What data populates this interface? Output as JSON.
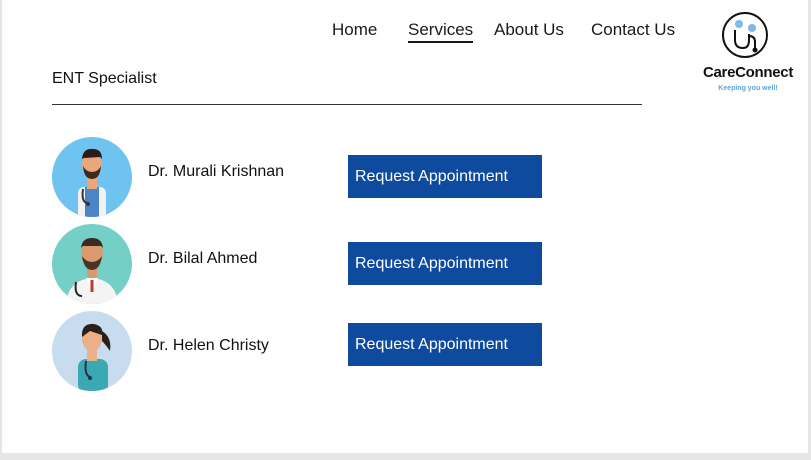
{
  "nav": {
    "items": [
      {
        "label": "Home",
        "active": false
      },
      {
        "label": "Services",
        "active": true
      },
      {
        "label": "About Us",
        "active": false
      },
      {
        "label": "Contact Us",
        "active": false
      }
    ]
  },
  "logo": {
    "name": "CareConnect",
    "tagline": "Keeping you well!",
    "icon": "stethoscope-people-icon",
    "tagline_color": "#5aa6df"
  },
  "section": {
    "title": "ENT Specialist"
  },
  "doctors": [
    {
      "name": "Dr. Murali Krishnan",
      "avatar": "male-doctor-bearded-avatar",
      "avatar_bg": "#6fc3f0",
      "button_label": "Request Appointment"
    },
    {
      "name": "Dr. Bilal Ahmed",
      "avatar": "male-doctor-white-coat-avatar",
      "avatar_bg": "#74cfc6",
      "button_label": "Request Appointment"
    },
    {
      "name": "Dr. Helen Christy",
      "avatar": "female-doctor-avatar",
      "avatar_bg": "#c7dcef",
      "button_label": "Request Appointment"
    }
  ],
  "colors": {
    "button_bg": "#0e4a9e",
    "button_text": "#ffffff"
  }
}
